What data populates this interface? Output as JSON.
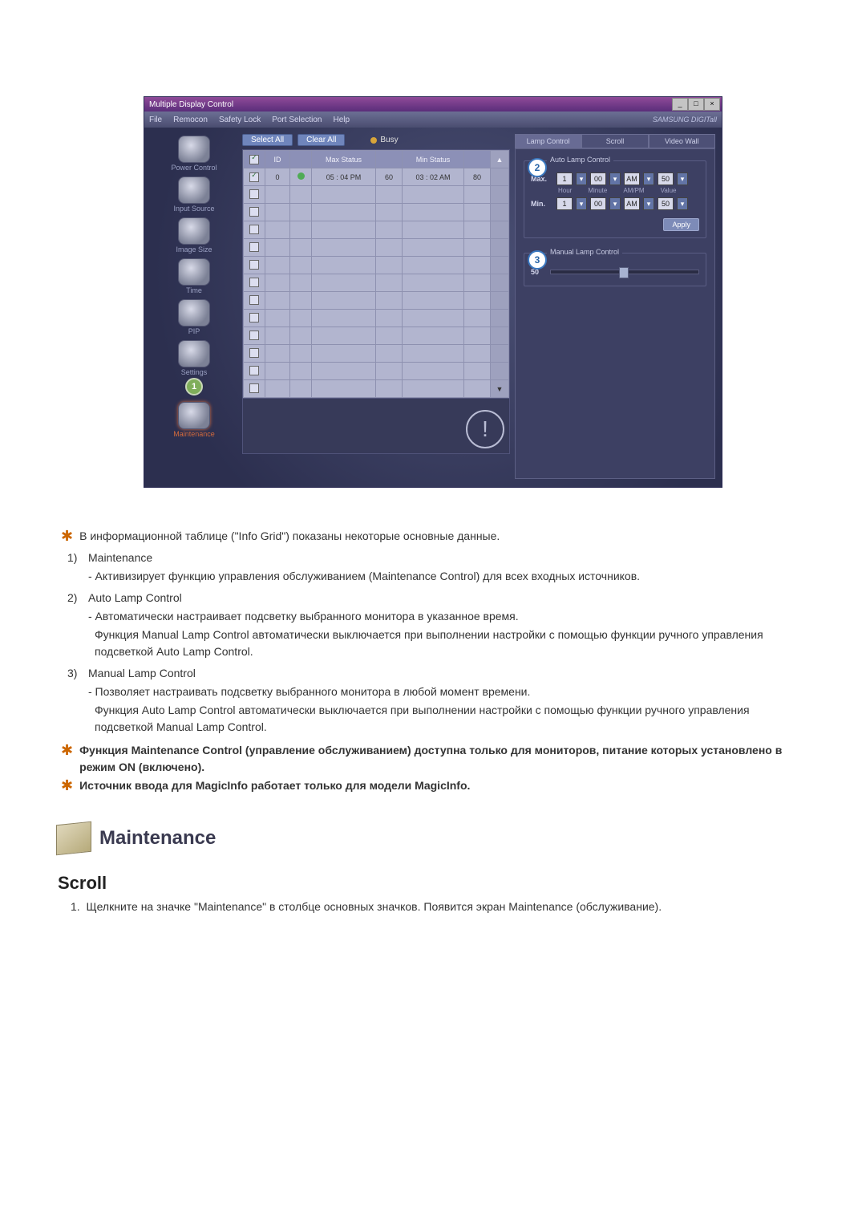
{
  "app": {
    "title": "Multiple Display Control",
    "menu": {
      "file": "File",
      "remocon": "Remocon",
      "safety_lock": "Safety Lock",
      "port_selection": "Port Selection",
      "help": "Help"
    },
    "brand": "SAMSUNG DIGITall"
  },
  "sidebar": {
    "items": [
      {
        "label": "Power Control"
      },
      {
        "label": "Input Source"
      },
      {
        "label": "Image Size"
      },
      {
        "label": "Time"
      },
      {
        "label": "PIP"
      },
      {
        "label": "Settings"
      },
      {
        "label": "Maintenance"
      }
    ],
    "marker1": "1"
  },
  "controls": {
    "select_all": "Select All",
    "clear_all": "Clear All",
    "busy": "Busy"
  },
  "grid": {
    "headers": {
      "chk": "",
      "id": "ID",
      "status": "",
      "max": "Max Status",
      "max_v": "",
      "min": "Min Status",
      "min_v": ""
    },
    "row0": {
      "id": "0",
      "max": "05 : 04 PM",
      "maxv": "60",
      "min": "03 : 02 AM",
      "minv": "80"
    },
    "blank_rows": 12
  },
  "right": {
    "tabs": {
      "lamp": "Lamp Control",
      "scroll": "Scroll",
      "videowall": "Video Wall"
    },
    "auto": {
      "marker": "2",
      "title": "Auto Lamp Control",
      "max_label": "Max.",
      "min_label": "Min.",
      "hour": "1",
      "minute": "00",
      "ampm": "AM",
      "value": "50",
      "sub_hour": "Hour",
      "sub_minute": "Minute",
      "sub_ampm": "AM/PM",
      "sub_value": "Value",
      "apply": "Apply"
    },
    "manual": {
      "marker": "3",
      "title": "Manual Lamp Control",
      "value": "50"
    }
  },
  "doc": {
    "star1": "В информационной таблице (\"Info Grid\") показаны некоторые основные данные.",
    "i1_n": "1)",
    "i1_t": "Maintenance",
    "i1_s1": "- Активизирует функцию управления обслуживанием (Maintenance Control) для всех входных источников.",
    "i2_n": "2)",
    "i2_t": "Auto Lamp Control",
    "i2_s1": "- Автоматически настраивает подсветку выбранного монитора в указанное время.",
    "i2_s2": "Функция Manual Lamp Control автоматически выключается при выполнении настройки с помощью функции ручного управления подсветкой Auto Lamp Control.",
    "i3_n": "3)",
    "i3_t": "Manual Lamp Control",
    "i3_s1": "- Позволяет настраивать подсветку выбранного монитора в любой момент времени.",
    "i3_s2": "Функция Auto Lamp Control автоматически выключается при выполнении настройки с помощью функции ручного управления подсветкой Manual Lamp Control.",
    "star2": "Функция Maintenance Control (управление обслуживанием) доступна только для мониторов, питание которых установлено в режим ON (включено).",
    "star3": "Источник ввода для MagicInfo работает только для модели MagicInfo.",
    "section_title": "Maintenance",
    "sub_title": "Scroll",
    "p1_n": "1.",
    "p1_t": "Щелкните на значке \"Maintenance\" в столбце основных значков. Появится экран Maintenance (обслуживание)."
  }
}
